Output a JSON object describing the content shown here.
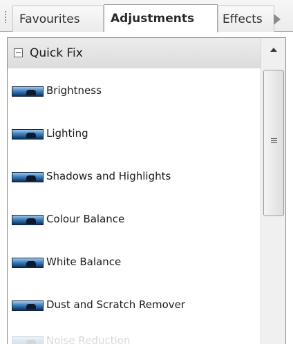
{
  "tabs": [
    {
      "label": "Favourites",
      "active": false
    },
    {
      "label": "Adjustments",
      "active": true
    },
    {
      "label": "Effects",
      "active": false
    }
  ],
  "group": {
    "title": "Quick Fix",
    "expanded": true
  },
  "items": [
    {
      "label": "Brightness",
      "icon": "photo-thumbnail-icon"
    },
    {
      "label": "Lighting",
      "icon": "photo-thumbnail-icon"
    },
    {
      "label": "Shadows and Highlights",
      "icon": "photo-thumbnail-icon"
    },
    {
      "label": "Colour Balance",
      "icon": "photo-thumbnail-icon"
    },
    {
      "label": "White Balance",
      "icon": "photo-thumbnail-icon"
    },
    {
      "label": "Dust and Scratch Remover",
      "icon": "photo-thumbnail-icon"
    },
    {
      "label": "Noise Reduction",
      "icon": "photo-thumbnail-icon"
    }
  ],
  "colors": {
    "active_tab_bg": "#ffffff",
    "header_bg": "#e2e2e2",
    "thumbnail_blue": "#3d7fbf"
  }
}
